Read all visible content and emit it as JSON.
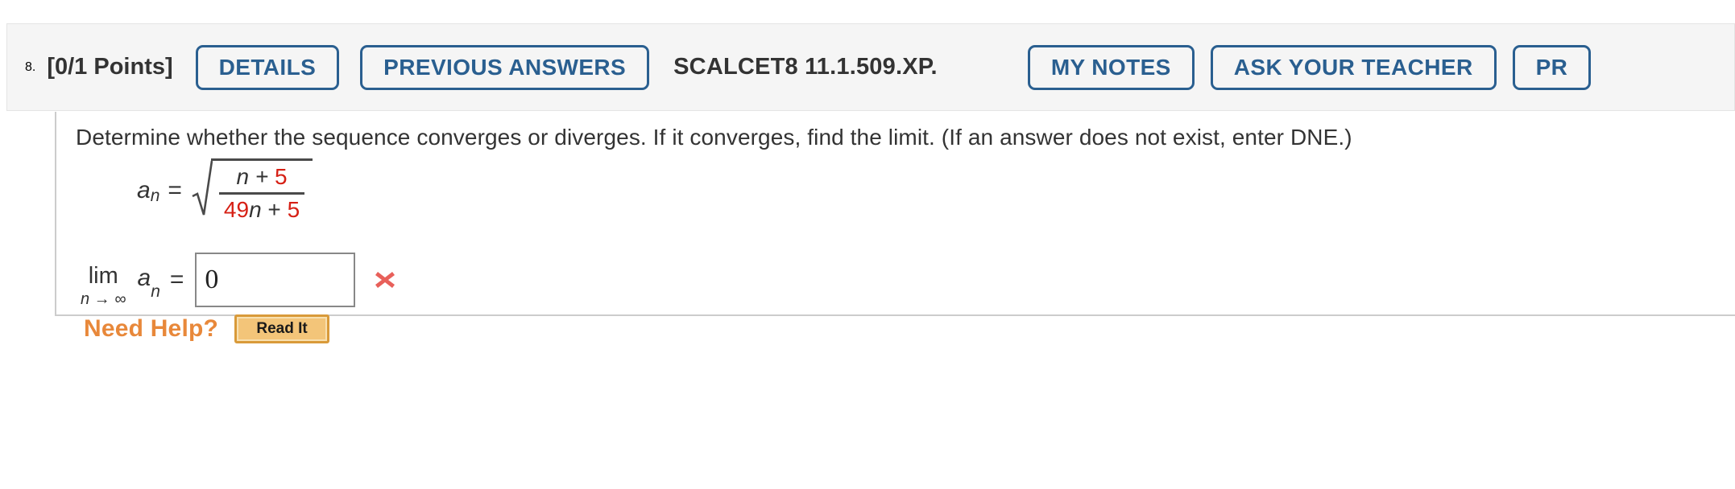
{
  "header": {
    "question_number": "8.",
    "points_badge": "[0/1 Points]",
    "details_label": "DETAILS",
    "previous_answers_label": "PREVIOUS ANSWERS",
    "problem_code": "SCALCET8 11.1.509.XP.",
    "my_notes_label": "MY NOTES",
    "ask_your_teacher_label": "ASK YOUR TEACHER",
    "practice_another_label": "PR",
    "background_color": "#f5f5f5",
    "button_border_color": "#2a5f90"
  },
  "question": {
    "prompt": "Determine whether the sequence converges or diverges. If it converges, find the limit. (If an answer does not exist, enter DNE.)",
    "formula": {
      "lhs_variable": "a",
      "lhs_subscript": "n",
      "equals": "=",
      "radical_numerator_term": "n + ",
      "radical_numerator_red": "5",
      "radical_denominator_red_coeff": "49",
      "radical_denominator_var": "n",
      "radical_denominator_plus": " + ",
      "radical_denominator_red_const": "5",
      "red_color": "#d62015"
    },
    "limit": {
      "lim_word": "lim",
      "lim_subscript": "n → ∞",
      "expression": "a",
      "expression_subscript": "n",
      "equals": "=",
      "answer_value": "0",
      "answer_placeholder": "",
      "grade_mark": "incorrect",
      "grade_mark_color": "#e8605a"
    }
  },
  "need_help": {
    "label": "Need Help?",
    "read_it_label": "Read It",
    "label_color": "#e8883a",
    "button_fill": "#f3c579",
    "button_border": "#d99a3a"
  }
}
